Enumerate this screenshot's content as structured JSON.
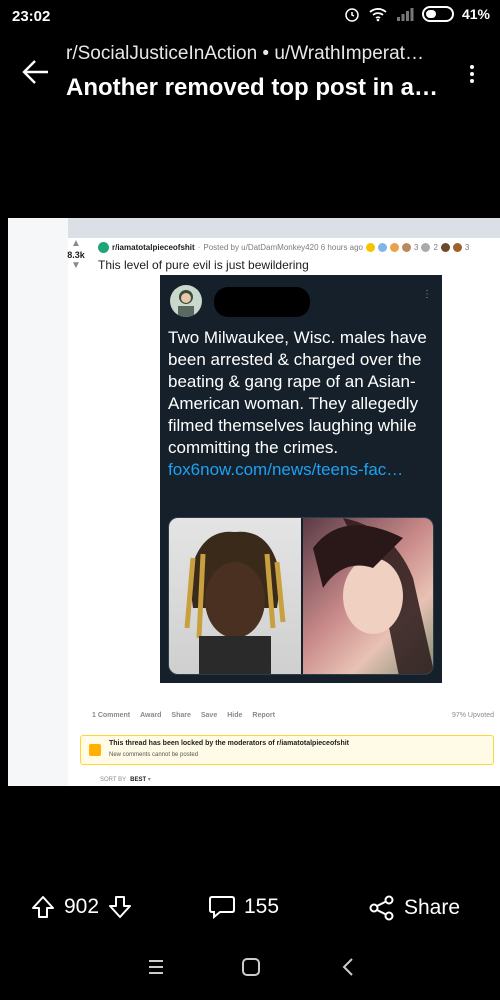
{
  "status_bar": {
    "time": "23:02",
    "battery": "41%",
    "battery_level": 0.41
  },
  "header": {
    "subtitle": "r/SocialJusticeInAction • u/WrathImperat…",
    "title": "Another removed top post in a…"
  },
  "post_image": {
    "subreddit": "r/iamatotalpieceofshit",
    "posted_by": "Posted by u/DatDamMonkey420 6 hours ago",
    "award_count_a": "3",
    "award_count_b": "2",
    "award_count_c": "3",
    "score": "8.3k",
    "title": "This level of pure evil is just bewildering",
    "tweet": {
      "text": "Two Milwaukee, Wisc. males have been arrested & charged over the beating & gang rape of an Asian-American woman. They allegedly filmed themselves laughing while committing the crimes.",
      "link": "fox6now.com/news/teens-fac…",
      "menu": "⋮"
    },
    "actions": {
      "comments": "1 Comment",
      "award": "Award",
      "share": "Share",
      "save": "Save",
      "hide": "Hide",
      "report": "Report"
    },
    "upvoted": "97% Upvoted",
    "locked_title": "This thread has been locked by the moderators of r/iamatotalpieceofshit",
    "locked_sub": "New comments cannot be posted",
    "sort_label": "SORT BY",
    "sort_value": "BEST"
  },
  "bottom_bar": {
    "upvotes": "902",
    "comments": "155",
    "share": "Share"
  },
  "colors": {
    "accent_link": "#1da1f2",
    "tweet_bg": "#15202b",
    "lock_banner": "#ffd635"
  }
}
